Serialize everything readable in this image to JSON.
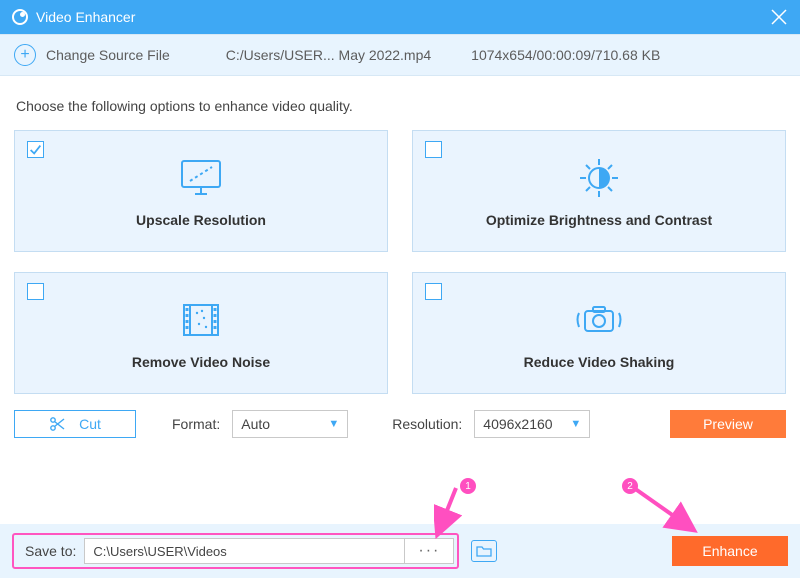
{
  "titlebar": {
    "title": "Video Enhancer"
  },
  "source": {
    "change_label": "Change Source File",
    "path": "C:/Users/USER... May 2022.mp4",
    "meta": "1074x654/00:00:09/710.68 KB"
  },
  "instruction": "Choose the following options to enhance video quality.",
  "options": {
    "upscale": {
      "label": "Upscale Resolution",
      "checked": true
    },
    "brightness": {
      "label": "Optimize Brightness and Contrast",
      "checked": false
    },
    "noise": {
      "label": "Remove Video Noise",
      "checked": false
    },
    "shaking": {
      "label": "Reduce Video Shaking",
      "checked": false
    }
  },
  "controls": {
    "cut_label": "Cut",
    "format_label": "Format:",
    "format_value": "Auto",
    "resolution_label": "Resolution:",
    "resolution_value": "4096x2160",
    "preview_label": "Preview"
  },
  "save": {
    "label": "Save to:",
    "path": "C:\\Users\\USER\\Videos",
    "browse_label": "···",
    "enhance_label": "Enhance"
  },
  "annotations": {
    "one": "1",
    "two": "2"
  }
}
